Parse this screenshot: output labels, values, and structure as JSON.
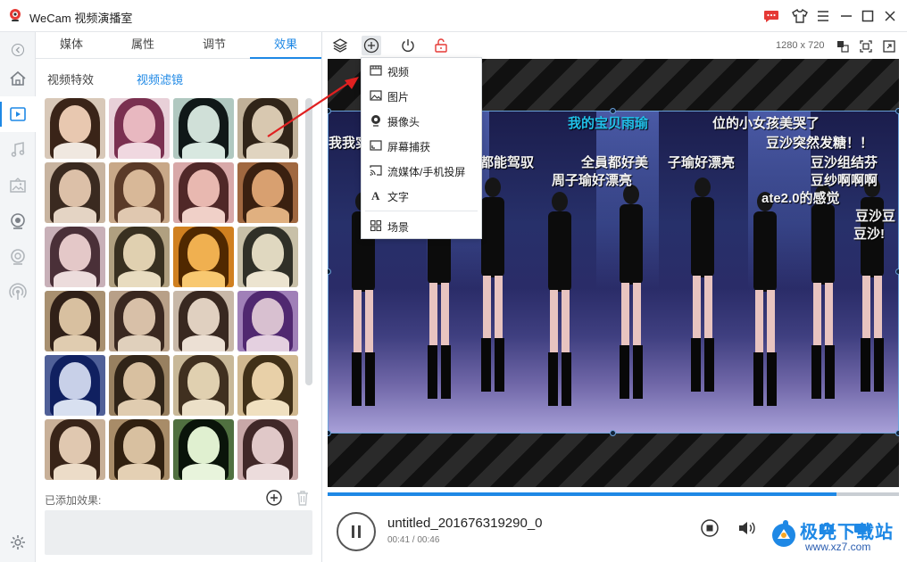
{
  "app": {
    "title": "WeCam 视频演播室"
  },
  "panel": {
    "tabs": [
      {
        "label": "媒体",
        "active": false
      },
      {
        "label": "属性",
        "active": false
      },
      {
        "label": "调节",
        "active": false
      },
      {
        "label": "效果",
        "active": true
      }
    ],
    "subtabs": [
      {
        "label": "视频特效",
        "active": false
      },
      {
        "label": "视频滤镜",
        "active": true
      }
    ],
    "filters": [
      {
        "skin": "#e8c8b0",
        "hair": "#3a2418",
        "bg": "#d8c8b8",
        "body": "#f0e8e0"
      },
      {
        "skin": "#e8b8c0",
        "hair": "#7a3050",
        "bg": "#e8d0d8",
        "body": "#f0d8e0"
      },
      {
        "skin": "#d0e0d8",
        "hair": "#101818",
        "bg": "#b0c8c0",
        "body": "#d8e8e0"
      },
      {
        "skin": "#d8c8b0",
        "hair": "#302418",
        "bg": "#c0b098",
        "body": "#e0d4c0"
      },
      {
        "skin": "#dcc0a8",
        "hair": "#3a2a20",
        "bg": "#c8b4a0",
        "body": "#e4d4c4"
      },
      {
        "skin": "#d8b898",
        "hair": "#5a3a28",
        "bg": "#c8a888",
        "body": "#e0c8b0"
      },
      {
        "skin": "#e8b8b0",
        "hair": "#502828",
        "bg": "#d8a8a8",
        "body": "#f0d0c8"
      },
      {
        "skin": "#d8a070",
        "hair": "#3a2010",
        "bg": "#a06840",
        "body": "#e0b080"
      },
      {
        "skin": "#e4c8c8",
        "hair": "#4a3038",
        "bg": "#c8b0b8",
        "body": "#ecdcdc"
      },
      {
        "skin": "#e0d0b0",
        "hair": "#383020",
        "bg": "#b0a080",
        "body": "#e8dcc0"
      },
      {
        "skin": "#f0b050",
        "hair": "#502800",
        "bg": "#d08020",
        "body": "#f8c870"
      },
      {
        "skin": "#e0d8c0",
        "hair": "#303028",
        "bg": "#c8c0a8",
        "body": "#ece4d0"
      },
      {
        "skin": "#d8c0a0",
        "hair": "#302018",
        "bg": "#a89070",
        "body": "#e0ccb0"
      },
      {
        "skin": "#d8c0a8",
        "hair": "#3a2820",
        "bg": "#b8a088",
        "body": "#e0d0bc"
      },
      {
        "skin": "#e0d0c0",
        "hair": "#382820",
        "bg": "#c8b8a8",
        "body": "#ece0d4"
      },
      {
        "skin": "#d8c0d0",
        "hair": "#502870",
        "bg": "#a080b8",
        "body": "#e4d0e0"
      },
      {
        "skin": "#c8d0e8",
        "hair": "#102060",
        "bg": "#506098",
        "body": "#d8e0f0"
      },
      {
        "skin": "#d8c0a0",
        "hair": "#302418",
        "bg": "#988060",
        "body": "#e0ccb0"
      },
      {
        "skin": "#e0d0b0",
        "hair": "#403020",
        "bg": "#c8b898",
        "body": "#ece0c8"
      },
      {
        "skin": "#e8d0a8",
        "hair": "#403018",
        "bg": "#d0b890",
        "body": "#f0e0c0"
      },
      {
        "skin": "#e0c8b0",
        "hair": "#382418",
        "bg": "#c8b098",
        "body": "#ecdcc8"
      },
      {
        "skin": "#d8c0a0",
        "hair": "#302010",
        "bg": "#a88c68",
        "body": "#e4d0b4"
      },
      {
        "skin": "#e0f0d0",
        "hair": "#0a140a",
        "bg": "#507040",
        "body": "#e8f4dc"
      },
      {
        "skin": "#e0c8c8",
        "hair": "#402828",
        "bg": "#c8a8a8",
        "body": "#ecdcdc"
      }
    ],
    "added_label": "已添加效果:"
  },
  "preview": {
    "resolution": "1280 x 720",
    "progress_fraction": 0.89,
    "file_name": "untitled_201676319290_0",
    "time": "00:41 / 00:46"
  },
  "danmu": [
    {
      "text": "我的宝贝雨瑜",
      "color": "#21c0e8"
    },
    {
      "text": "位的小女孩美哭了",
      "color": "#f4f4f4"
    },
    {
      "text": "我我实",
      "color": "#f4f4f4"
    },
    {
      "text": "豆沙突然发糖！！",
      "color": "#f4f4f4"
    },
    {
      "text": "都能驾驭",
      "color": "#f4f4f4"
    },
    {
      "text": "全員都好美",
      "color": "#f4f4f4"
    },
    {
      "text": "子瑜好漂亮",
      "color": "#f4f4f4"
    },
    {
      "text": "豆沙组结芬",
      "color": "#f4f4f4"
    },
    {
      "text": "周子瑜好漂亮",
      "color": "#f4f4f4"
    },
    {
      "text": "豆纱啊啊啊",
      "color": "#f4f4f4"
    },
    {
      "text": "ate2.0的感觉",
      "color": "#f4f4f4"
    },
    {
      "text": "豆沙豆",
      "color": "#f4f4f4"
    },
    {
      "text": "豆沙!",
      "color": "#f4f4f4"
    }
  ],
  "menu": {
    "items": [
      {
        "label": "视频",
        "icon": "video-icon"
      },
      {
        "label": "图片",
        "icon": "image-icon"
      },
      {
        "label": "摄像头",
        "icon": "webcam-icon"
      },
      {
        "label": "屏幕捕获",
        "icon": "screen-capture-icon"
      },
      {
        "label": "流媒体/手机投屏",
        "icon": "cast-icon"
      },
      {
        "label": "文字",
        "icon": "text-icon"
      },
      {
        "label": "场景",
        "icon": "scene-icon"
      }
    ]
  },
  "watermark": {
    "text": "极光下载站",
    "url": "www.xz7.com"
  },
  "colors": {
    "accent": "#1e88e5",
    "arrow": "#e02020",
    "lock": "#e53935",
    "chat": "#e53935"
  }
}
